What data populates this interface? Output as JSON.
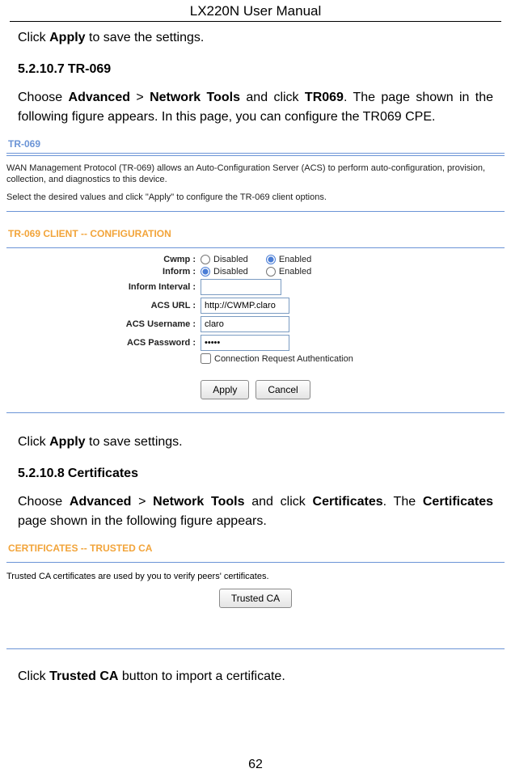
{
  "header": {
    "title": "LX220N User Manual"
  },
  "intro1": {
    "pre": "Click ",
    "b1": "Apply",
    "post": " to save the settings."
  },
  "sec1": {
    "num": "5.2.10.7",
    "title": "TR-069",
    "line1_pre": "Choose ",
    "line1_b1": "Advanced",
    "line1_mid1": " > ",
    "line1_b2": "Network Tools",
    "line1_mid2": " and click ",
    "line1_b3": "TR069",
    "line1_post": ". The page shown in the following figure appears. In this page, you can configure the TR069 CPE."
  },
  "tr069": {
    "panel_title": "TR-069",
    "desc1": "WAN Management Protocol (TR-069) allows an Auto-Configuration Server (ACS) to perform auto-configuration, provision, collection, and diagnostics to this device.",
    "desc2": "Select the desired values and click \"Apply\" to configure the TR-069 client options.",
    "sub_title": "TR-069 CLIENT -- CONFIGURATION",
    "labels": {
      "cwmp": "Cwmp :",
      "inform": "Inform :",
      "interval": "Inform Interval :",
      "acs_url": "ACS URL :",
      "acs_user": "ACS Username :",
      "acs_pass": "ACS Password :"
    },
    "options": {
      "disabled": "Disabled",
      "enabled": "Enabled"
    },
    "values": {
      "cwmp_selected": "Enabled",
      "inform_selected": "Disabled",
      "interval": "",
      "acs_url": "http://CWMP.claro",
      "acs_user": "claro",
      "acs_pass": "•••••"
    },
    "chk_label": "Connection Request Authentication",
    "buttons": {
      "apply": "Apply",
      "cancel": "Cancel"
    }
  },
  "mid": {
    "pre": "Click ",
    "b1": "Apply",
    "post": " to save settings."
  },
  "sec2": {
    "num": "5.2.10.8",
    "title": "Certificates",
    "line_pre": "Choose ",
    "line_b1": "Advanced",
    "line_mid1": " > ",
    "line_b2": "Network Tools",
    "line_mid2": " and click ",
    "line_b3": "Certificates",
    "line_mid3": ". The ",
    "line_b4": "Certificates",
    "line_post": " page shown in the following figure appears."
  },
  "cert": {
    "panel_title": "CERTIFICATES -- TRUSTED CA",
    "desc": "Trusted CA certificates are used by you to verify peers' certificates.",
    "button": "Trusted CA"
  },
  "closing": {
    "pre": "Click ",
    "b1": "Trusted CA",
    "post": " button to import a certificate."
  },
  "page_number": "62"
}
